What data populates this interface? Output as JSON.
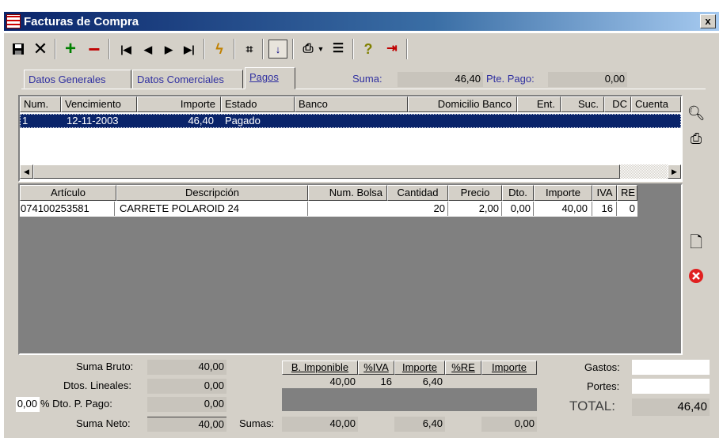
{
  "window": {
    "title": "Facturas de Compra",
    "close_label": "x"
  },
  "toolbar": {
    "items": [
      "save-icon",
      "cancel-icon",
      "add-icon",
      "remove-icon",
      "first-icon",
      "prev-icon",
      "next-icon",
      "last-icon",
      "lightning-icon",
      "binoculars-icon",
      "sort-icon",
      "printer-icon",
      "dropdown-icon",
      "report-icon",
      "help-icon",
      "exit-icon"
    ]
  },
  "tabs": [
    {
      "label": "Datos Generales",
      "active": false
    },
    {
      "label": "Datos Comerciales",
      "active": false
    },
    {
      "label": "Pagos",
      "active": true
    }
  ],
  "summary": {
    "suma_label": "Suma:",
    "suma_value": "46,40",
    "pte_label": "Pte. Pago:",
    "pte_value": "0,00"
  },
  "payments": {
    "columns": [
      "Num.",
      "Vencimiento",
      "Importe",
      "Estado",
      "Banco",
      "Domicilio Banco",
      "Ent.",
      "Suc.",
      "DC",
      "Cuenta"
    ],
    "rows": [
      {
        "num": "1",
        "vencimiento": "12-11-2003",
        "importe": "46,40",
        "estado": "Pagado"
      }
    ]
  },
  "lines": {
    "columns": [
      "Artículo",
      "Descripción",
      "Num. Bolsa",
      "Cantidad",
      "Precio",
      "Dto.",
      "Importe",
      "IVA",
      "RE"
    ],
    "rows": [
      {
        "articulo": "074100253581",
        "descripcion": "CARRETE POLAROID 24",
        "bolsa": "",
        "cantidad": "20",
        "precio": "2,00",
        "dto": "0,00",
        "importe": "40,00",
        "iva": "16",
        "re": "0"
      }
    ]
  },
  "totals": {
    "suma_bruto_label": "Suma Bruto:",
    "suma_bruto": "40,00",
    "dtos_lineales_label": "Dtos. Lineales:",
    "dtos_lineales": "0,00",
    "dto_pp_pct": "0,00",
    "dto_pp_label": "% Dto. P. Pago:",
    "dto_pp": "0,00",
    "suma_neto_label": "Suma Neto:",
    "suma_neto": "40,00",
    "sumas_label": "Sumas:",
    "sumas_base": "40,00",
    "sumas_iva": "6,40",
    "sumas_re": "0,00",
    "gastos_label": "Gastos:",
    "gastos": "",
    "portes_label": "Portes:",
    "portes": "",
    "total_label": "TOTAL:",
    "total": "46,40"
  },
  "tax_table": {
    "headers": [
      "B. Imponible",
      "%IVA",
      "Importe",
      "%RE",
      "Importe"
    ],
    "row": {
      "base": "40,00",
      "iva_pct": "16",
      "iva_importe": "6,40",
      "re_pct": "",
      "re_importe": ""
    }
  }
}
